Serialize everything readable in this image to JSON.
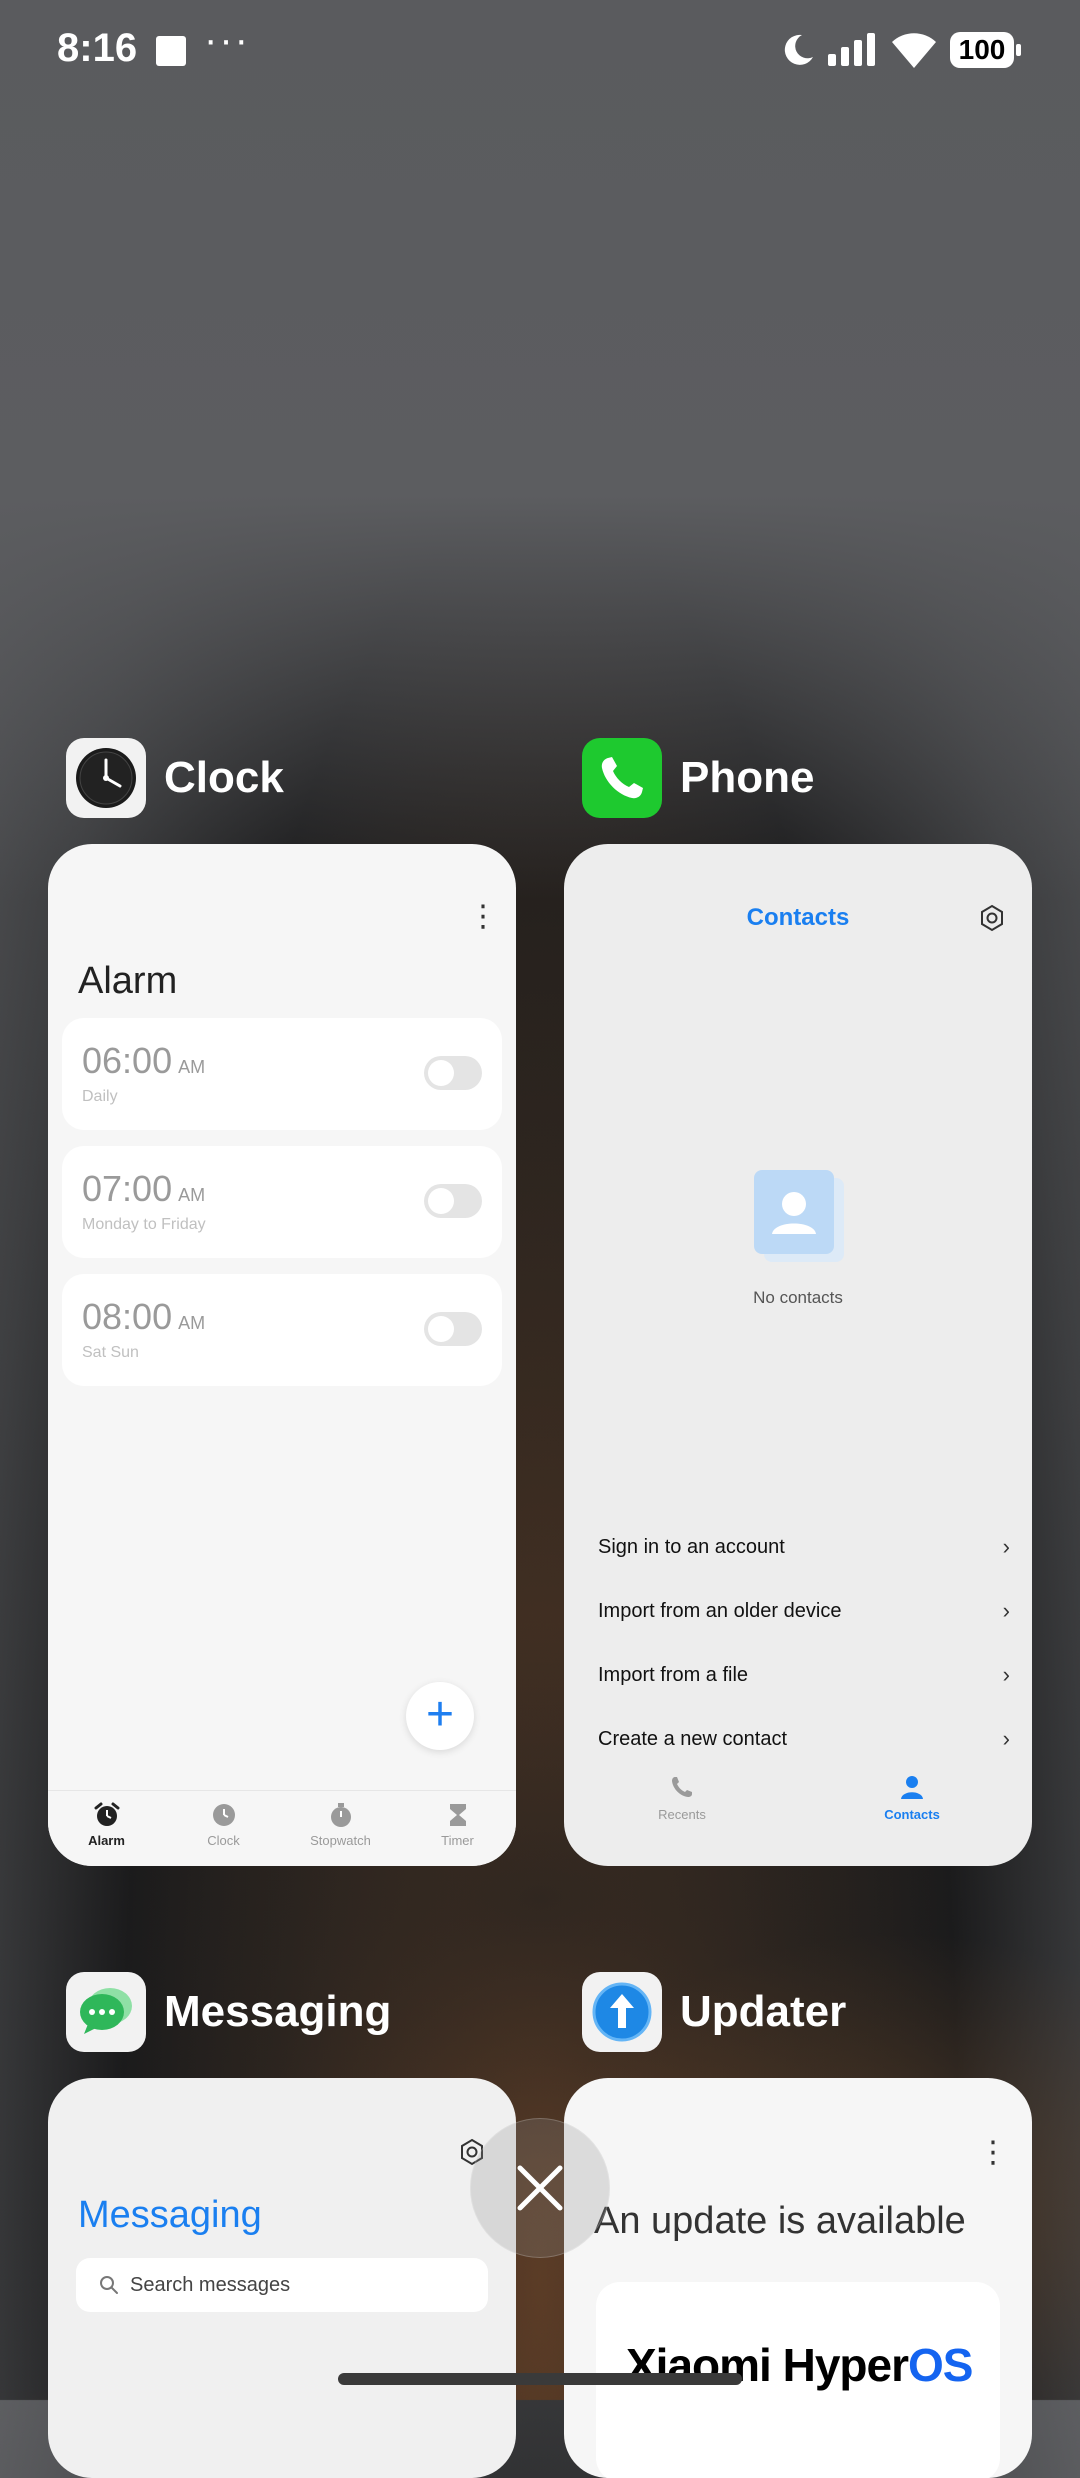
{
  "status_bar": {
    "time": "8:16",
    "more": "···",
    "battery": "100"
  },
  "apps": {
    "clock": {
      "name": "Clock",
      "title": "Alarm",
      "alarms": [
        {
          "time": "06:00",
          "ampm": "AM",
          "repeat": "Daily"
        },
        {
          "time": "07:00",
          "ampm": "AM",
          "repeat": "Monday to Friday"
        },
        {
          "time": "08:00",
          "ampm": "AM",
          "repeat": "Sat Sun"
        }
      ],
      "fab": "+",
      "tabs": [
        "Alarm",
        "Clock",
        "Stopwatch",
        "Timer"
      ]
    },
    "phone": {
      "name": "Phone",
      "title": "Contacts",
      "empty": "No contacts",
      "menu": [
        "Sign in to an account",
        "Import from an older device",
        "Import from a file",
        "Create a new contact"
      ],
      "tabs": [
        "Recents",
        "Contacts"
      ]
    },
    "messaging": {
      "name": "Messaging",
      "title": "Messaging",
      "search_placeholder": "Search messages"
    },
    "updater": {
      "name": "Updater",
      "title": "An update is available",
      "brand_main": "Xiaomi Hyper",
      "brand_os": "OS"
    }
  },
  "colors": {
    "accent": "#1a7ff0",
    "phone_icon": "#1ec92f",
    "messaging_icon": "#2fb75a"
  }
}
